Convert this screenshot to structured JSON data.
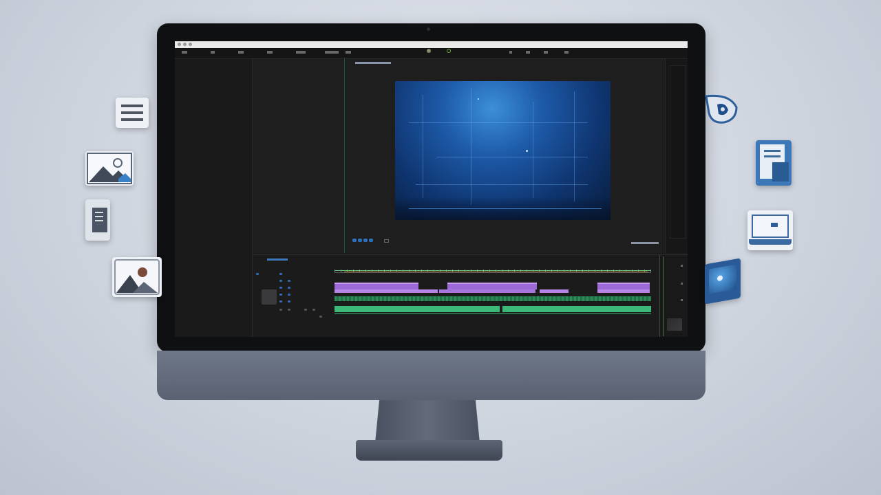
{
  "app": {
    "program_panel_label": "",
    "timecode": ""
  },
  "timeline": {
    "header_label": ""
  },
  "colors": {
    "video_clip": "#9b6ad6",
    "audio_clip": "#3cb878",
    "accent": "#2f6db8"
  },
  "floating_icons": [
    "menu-icon",
    "image-icon",
    "document-icon",
    "photo-icon",
    "pen-icon",
    "file-icon",
    "laptop-icon",
    "picture-icon"
  ]
}
